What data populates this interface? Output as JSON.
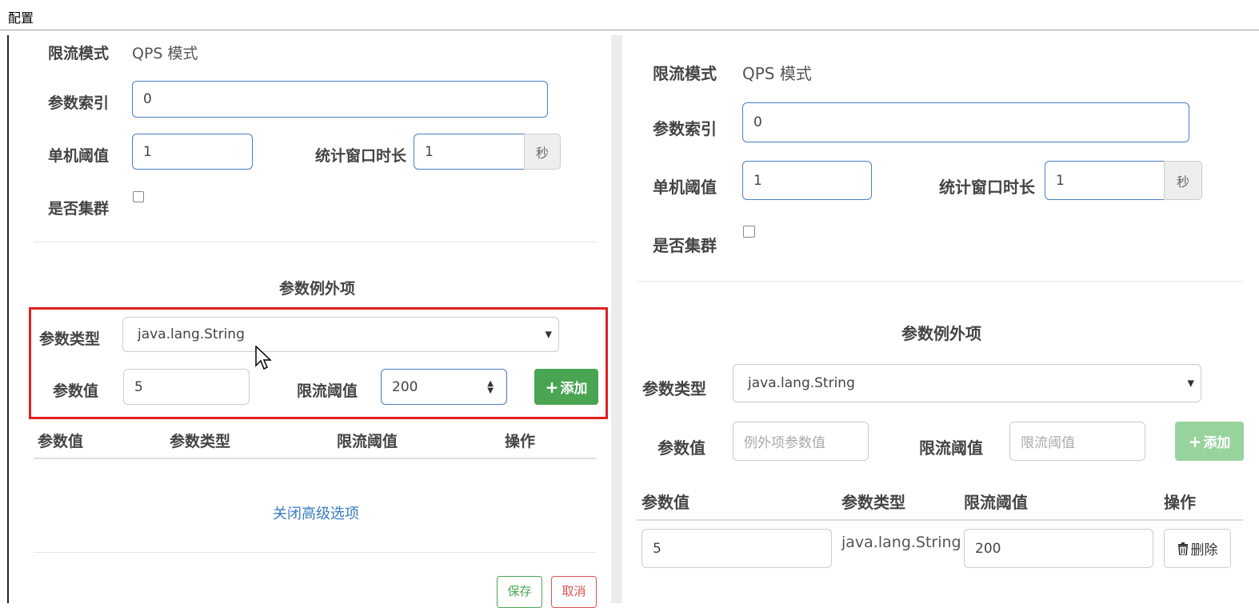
{
  "window": {
    "title": "配置"
  },
  "left": {
    "mode_label": "限流模式",
    "mode_value": "QPS 模式",
    "param_index_label": "参数索引",
    "param_index_value": "0",
    "threshold_label": "单机阈值",
    "threshold_value": "1",
    "window_label": "统计窗口时长",
    "window_value": "1",
    "window_unit": "秒",
    "cluster_label": "是否集群",
    "cluster_checked": false,
    "exceptions_title": "参数例外项",
    "param_type_label": "参数类型",
    "param_type_value": "java.lang.String",
    "param_value_label": "参数值",
    "param_value_value": "5",
    "limit_label": "限流阈值",
    "limit_value": "200",
    "add_button": "添加",
    "table_headers": [
      "参数值",
      "参数类型",
      "限流阈值",
      "操作"
    ],
    "close_advanced_link": "关闭高级选项",
    "save_button": "保存",
    "cancel_button": "取消"
  },
  "right": {
    "mode_label": "限流模式",
    "mode_value": "QPS 模式",
    "param_index_label": "参数索引",
    "param_index_value": "0",
    "threshold_label": "单机阈值",
    "threshold_value": "1",
    "window_label": "统计窗口时长",
    "window_value": "1",
    "window_unit": "秒",
    "cluster_label": "是否集群",
    "cluster_checked": false,
    "exceptions_title": "参数例外项",
    "param_type_label": "参数类型",
    "param_type_value": "java.lang.String",
    "param_value_label": "参数值",
    "param_value_placeholder": "例外项参数值",
    "limit_label": "限流阈值",
    "limit_placeholder": "限流阈值",
    "add_button": "添加",
    "table_headers": [
      "参数值",
      "参数类型",
      "限流阈值",
      "操作"
    ],
    "rows": [
      {
        "param_value": "5",
        "param_type": "java.lang.String",
        "limit": "200",
        "action": "删除"
      }
    ]
  },
  "colors": {
    "primary_border": "#4a7fc0",
    "green": "#4aa553",
    "highlight_red": "#e02020",
    "link": "#3a7cc0"
  }
}
